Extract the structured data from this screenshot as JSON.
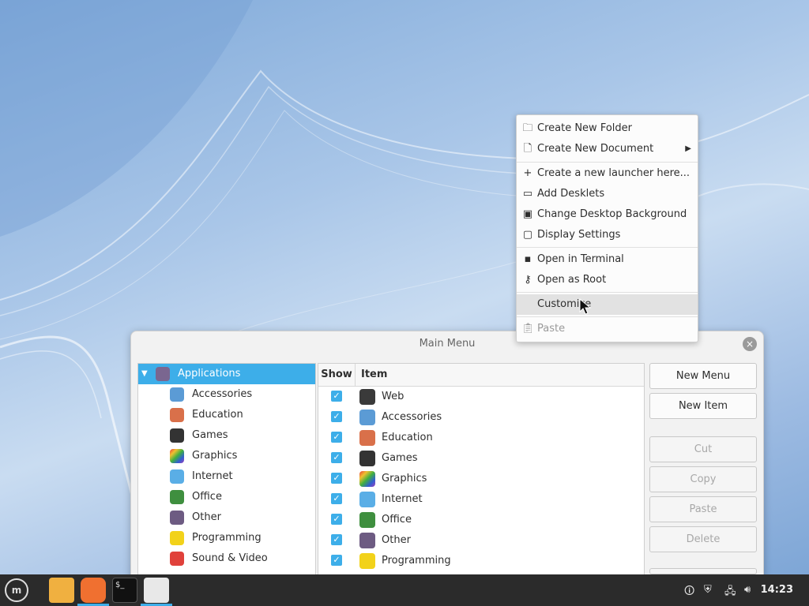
{
  "context_menu": {
    "items": [
      {
        "label": "Create New Folder",
        "icon": "new-folder-icon"
      },
      {
        "label": "Create New Document",
        "icon": "new-document-icon",
        "has_submenu": true
      },
      {
        "label": "Create a new launcher here...",
        "icon": "plus-icon"
      },
      {
        "label": "Add Desklets",
        "icon": "desklet-icon"
      },
      {
        "label": "Change Desktop Background",
        "icon": "wallpaper-icon"
      },
      {
        "label": "Display Settings",
        "icon": "display-icon"
      },
      {
        "label": "Open in Terminal",
        "icon": "terminal-icon"
      },
      {
        "label": "Open as Root",
        "icon": "key-icon"
      },
      {
        "label": "Customize",
        "icon": "",
        "hovered": true
      },
      {
        "label": "Paste",
        "icon": "clipboard-icon",
        "disabled": true
      }
    ]
  },
  "window": {
    "title": "Main Menu",
    "close_glyph": "×",
    "tree": {
      "root": {
        "label": "Applications"
      },
      "children": [
        {
          "label": "Accessories"
        },
        {
          "label": "Education"
        },
        {
          "label": "Games"
        },
        {
          "label": "Graphics"
        },
        {
          "label": "Internet"
        },
        {
          "label": "Office"
        },
        {
          "label": "Other"
        },
        {
          "label": "Programming"
        },
        {
          "label": "Sound & Video"
        }
      ]
    },
    "grid": {
      "columns": {
        "show": "Show",
        "item": "Item"
      },
      "rows": [
        {
          "label": "Web",
          "checked": true
        },
        {
          "label": "Accessories",
          "checked": true
        },
        {
          "label": "Education",
          "checked": true
        },
        {
          "label": "Games",
          "checked": true
        },
        {
          "label": "Graphics",
          "checked": true
        },
        {
          "label": "Internet",
          "checked": true
        },
        {
          "label": "Office",
          "checked": true
        },
        {
          "label": "Other",
          "checked": true
        },
        {
          "label": "Programming",
          "checked": true
        }
      ]
    },
    "buttons": {
      "new_menu": "New Menu",
      "new_item": "New Item",
      "cut": "Cut",
      "copy": "Copy",
      "paste": "Paste",
      "delete": "Delete"
    }
  },
  "taskbar": {
    "clock": "14:23"
  },
  "colors": {
    "accent": "#3daee9",
    "taskbar": "#2b2b2b"
  }
}
